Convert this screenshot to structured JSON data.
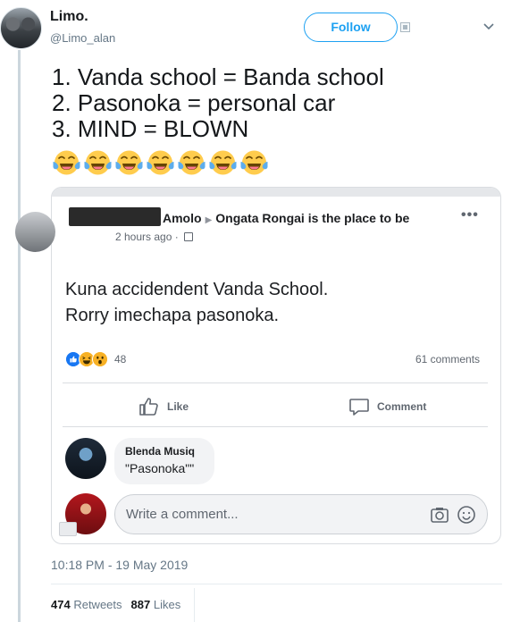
{
  "author": {
    "name": "Limo.",
    "handle": "@Limo_alan",
    "follow_label": "Follow"
  },
  "tweet": {
    "lines": [
      "1. Vanda school = Banda school",
      "2. Pasonoka = personal car",
      "3. MIND = BLOWN"
    ],
    "emoji_count": 7,
    "emoji_name": "tears-of-joy-emoji"
  },
  "fb_post": {
    "author": "Amolo",
    "group": "Ongata Rongai is the place to be",
    "time": "2 hours ago",
    "more": "•••",
    "text_lines": [
      "Kuna accidendent Vanda School.",
      "Rorry imechapa pasonoka."
    ],
    "reaction_count": "48",
    "comments_count": "61 comments",
    "like_label": "Like",
    "comment_label": "Comment",
    "comment": {
      "name": "Blenda Musiq",
      "text": "\"Pasonoka\"\""
    },
    "write_placeholder": "Write a comment..."
  },
  "footer": {
    "timestamp": "10:18 PM - 19 May 2019",
    "retweets_count": "474",
    "retweets_label": "Retweets",
    "likes_count": "887",
    "likes_label": "Likes"
  },
  "colors": {
    "twitter_blue": "#1da1f2",
    "fb_blue": "#1877f2",
    "text_secondary": "#657786"
  }
}
